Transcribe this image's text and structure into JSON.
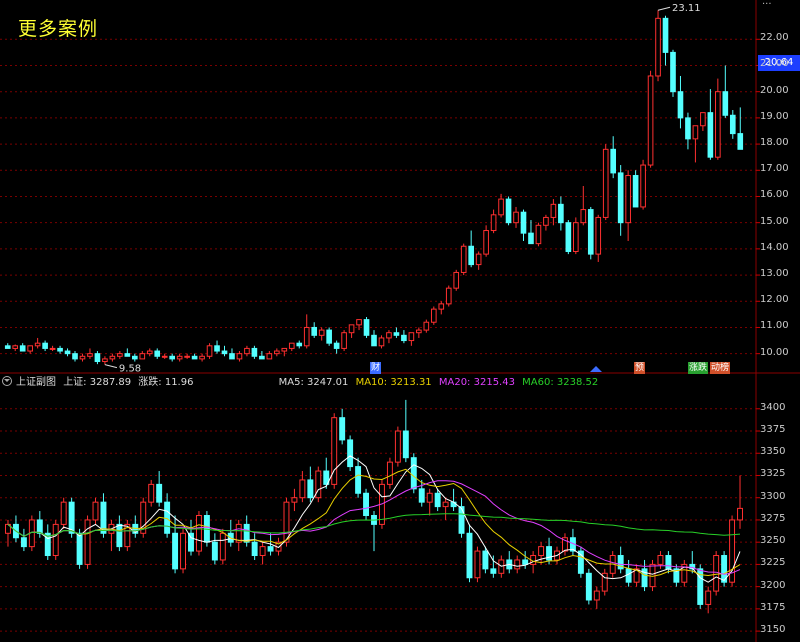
{
  "header": {
    "title": "更多案例"
  },
  "price_tag": "20.64",
  "top_partial_label": "...",
  "main_chart": {
    "y_ticks": [
      "22.00",
      "21.00",
      "20.00",
      "19.00",
      "18.00",
      "17.00",
      "16.00",
      "15.00",
      "14.00",
      "13.00",
      "12.00",
      "11.00",
      "10.00"
    ],
    "y_values": [
      22,
      21,
      20,
      19,
      18,
      17,
      16,
      15,
      14,
      13,
      12,
      11,
      10
    ],
    "ylim": [
      9.3,
      23.5
    ],
    "high_label": "23.11",
    "low_label": "9.58",
    "high_value": 23.11,
    "low_value": 9.58,
    "close_last": 20.64
  },
  "badges": [
    {
      "label": "财",
      "color": "#3b6cff"
    },
    {
      "label": "预",
      "color": "#d0502a"
    },
    {
      "label": "涨跌",
      "color": "#28a030"
    },
    {
      "label": "动榜",
      "color": "#d0502a"
    }
  ],
  "sub_header": {
    "name": "上证副图",
    "index_label": "上证: 3287.89",
    "change_label": "涨跌: 11.96",
    "ma5": "MA5: 3247.01",
    "ma10": "MA10: 3213.31",
    "ma20": "MA20: 3215.43",
    "ma60": "MA60: 3238.52"
  },
  "sub_chart": {
    "y_ticks": [
      "3400",
      "3375",
      "3350",
      "3325",
      "3300",
      "3275",
      "3250",
      "3225",
      "3200",
      "3175",
      "3150"
    ],
    "y_values": [
      3400,
      3375,
      3350,
      3325,
      3300,
      3275,
      3250,
      3225,
      3200,
      3175,
      3150
    ],
    "ylim": [
      3140,
      3420
    ]
  },
  "colors": {
    "up": "#ff3030",
    "down": "#54ffff",
    "grid": "#7a0000",
    "ma5": "#ffffff",
    "ma10": "#e8d000",
    "ma20": "#e040ff",
    "ma60": "#28d028"
  },
  "chart_data": [
    {
      "type": "candlestick",
      "title": "",
      "ylim": [
        9.3,
        23.5
      ],
      "candles": [
        [
          10.3,
          10.4,
          10.2,
          10.2
        ],
        [
          10.2,
          10.35,
          10.1,
          10.3
        ],
        [
          10.3,
          10.4,
          10.2,
          10.1
        ],
        [
          10.1,
          10.3,
          10.0,
          10.3
        ],
        [
          10.3,
          10.6,
          10.2,
          10.4
        ],
        [
          10.4,
          10.5,
          10.1,
          10.2
        ],
        [
          10.2,
          10.3,
          10.1,
          10.2
        ],
        [
          10.2,
          10.3,
          10.0,
          10.1
        ],
        [
          10.1,
          10.2,
          9.9,
          10.0
        ],
        [
          10.0,
          10.1,
          9.7,
          9.8
        ],
        [
          9.8,
          10.0,
          9.7,
          9.9
        ],
        [
          9.9,
          10.2,
          9.8,
          10.0
        ],
        [
          10.0,
          10.1,
          9.6,
          9.7
        ],
        [
          9.7,
          9.9,
          9.58,
          9.8
        ],
        [
          9.8,
          10.0,
          9.7,
          9.9
        ],
        [
          9.9,
          10.1,
          9.8,
          10.0
        ],
        [
          10.0,
          10.2,
          9.9,
          9.9
        ],
        [
          9.9,
          10.0,
          9.7,
          9.8
        ],
        [
          9.8,
          10.1,
          9.8,
          10.0
        ],
        [
          10.0,
          10.2,
          9.9,
          10.1
        ],
        [
          10.1,
          10.2,
          9.8,
          9.9
        ],
        [
          9.9,
          10.0,
          9.8,
          9.9
        ],
        [
          9.9,
          10.0,
          9.7,
          9.8
        ],
        [
          9.8,
          10.0,
          9.7,
          9.9
        ],
        [
          9.9,
          10.0,
          9.8,
          9.9
        ],
        [
          9.9,
          10.0,
          9.8,
          9.8
        ],
        [
          9.8,
          10.0,
          9.7,
          9.9
        ],
        [
          9.9,
          10.4,
          9.8,
          10.3
        ],
        [
          10.3,
          10.5,
          10.0,
          10.1
        ],
        [
          10.1,
          10.3,
          9.9,
          10.0
        ],
        [
          10.0,
          10.2,
          9.8,
          9.8
        ],
        [
          9.8,
          10.1,
          9.7,
          10.0
        ],
        [
          10.0,
          10.3,
          9.9,
          10.2
        ],
        [
          10.2,
          10.3,
          9.8,
          9.9
        ],
        [
          9.9,
          10.1,
          9.8,
          9.8
        ],
        [
          9.8,
          10.1,
          9.8,
          10.0
        ],
        [
          10.0,
          10.2,
          9.9,
          10.1
        ],
        [
          10.1,
          10.2,
          9.9,
          10.2
        ],
        [
          10.2,
          10.4,
          10.1,
          10.4
        ],
        [
          10.4,
          10.5,
          10.2,
          10.3
        ],
        [
          10.3,
          11.5,
          10.2,
          11.0
        ],
        [
          11.0,
          11.2,
          10.6,
          10.7
        ],
        [
          10.7,
          11.0,
          10.5,
          10.9
        ],
        [
          10.9,
          11.0,
          10.3,
          10.4
        ],
        [
          10.4,
          10.5,
          10.0,
          10.2
        ],
        [
          10.2,
          10.9,
          10.1,
          10.8
        ],
        [
          10.8,
          11.1,
          10.6,
          11.1
        ],
        [
          11.1,
          11.3,
          10.9,
          11.3
        ],
        [
          11.3,
          11.4,
          10.6,
          10.7
        ],
        [
          10.7,
          10.9,
          10.3,
          10.3
        ],
        [
          10.3,
          10.7,
          10.2,
          10.6
        ],
        [
          10.6,
          10.9,
          10.4,
          10.8
        ],
        [
          10.8,
          11.0,
          10.6,
          10.7
        ],
        [
          10.7,
          10.9,
          10.4,
          10.5
        ],
        [
          10.5,
          10.8,
          10.3,
          10.8
        ],
        [
          10.8,
          11.0,
          10.6,
          10.9
        ],
        [
          10.9,
          11.3,
          10.8,
          11.2
        ],
        [
          11.2,
          11.8,
          11.1,
          11.7
        ],
        [
          11.7,
          12.0,
          11.5,
          11.9
        ],
        [
          11.9,
          12.6,
          11.8,
          12.5
        ],
        [
          12.5,
          13.2,
          12.4,
          13.1
        ],
        [
          13.1,
          14.2,
          13.0,
          14.1
        ],
        [
          14.1,
          14.7,
          13.3,
          13.4
        ],
        [
          13.4,
          13.9,
          13.2,
          13.8
        ],
        [
          13.8,
          14.9,
          13.7,
          14.7
        ],
        [
          14.7,
          15.5,
          14.6,
          15.3
        ],
        [
          15.3,
          16.1,
          15.2,
          15.9
        ],
        [
          15.9,
          16.0,
          14.9,
          15.0
        ],
        [
          15.0,
          15.6,
          14.8,
          15.4
        ],
        [
          15.4,
          15.5,
          14.3,
          14.6
        ],
        [
          14.6,
          15.1,
          14.2,
          14.2
        ],
        [
          14.2,
          15.0,
          14.1,
          14.9
        ],
        [
          14.9,
          15.3,
          14.7,
          15.2
        ],
        [
          15.2,
          15.9,
          14.9,
          15.7
        ],
        [
          15.7,
          16.0,
          14.7,
          15.0
        ],
        [
          15.0,
          15.1,
          13.8,
          13.9
        ],
        [
          13.9,
          15.2,
          13.8,
          15.0
        ],
        [
          15.0,
          16.4,
          14.9,
          15.5
        ],
        [
          15.5,
          15.6,
          13.6,
          13.8
        ],
        [
          13.8,
          15.3,
          13.5,
          15.2
        ],
        [
          15.2,
          18.0,
          15.1,
          17.8
        ],
        [
          17.8,
          18.3,
          16.7,
          16.9
        ],
        [
          16.9,
          17.2,
          14.5,
          15.0
        ],
        [
          15.0,
          17.0,
          14.3,
          16.8
        ],
        [
          16.8,
          17.0,
          15.6,
          15.6
        ],
        [
          15.6,
          17.4,
          15.5,
          17.2
        ],
        [
          17.2,
          20.8,
          17.1,
          20.6
        ],
        [
          20.6,
          23.11,
          20.4,
          22.8
        ],
        [
          22.8,
          22.9,
          21.0,
          21.5
        ],
        [
          21.5,
          21.6,
          19.8,
          20.0
        ],
        [
          20.0,
          20.6,
          18.6,
          19.0
        ],
        [
          19.0,
          19.2,
          17.8,
          18.2
        ],
        [
          18.2,
          18.7,
          17.3,
          18.7
        ],
        [
          18.7,
          19.2,
          18.5,
          19.2
        ],
        [
          19.2,
          20.1,
          17.4,
          17.5
        ],
        [
          17.5,
          20.5,
          17.4,
          20.0
        ],
        [
          20.0,
          21.0,
          19.0,
          19.1
        ],
        [
          19.1,
          19.3,
          18.2,
          18.4
        ],
        [
          18.4,
          19.4,
          17.8,
          17.8
        ]
      ]
    },
    {
      "type": "candlestick",
      "title": "上证副图",
      "ylim": [
        3140,
        3420
      ],
      "series_names": [
        "MA5",
        "MA10",
        "MA20",
        "MA60"
      ],
      "candles": [
        [
          3260,
          3275,
          3245,
          3270
        ],
        [
          3270,
          3280,
          3250,
          3255
        ],
        [
          3255,
          3265,
          3240,
          3245
        ],
        [
          3245,
          3280,
          3240,
          3275
        ],
        [
          3275,
          3285,
          3255,
          3260
        ],
        [
          3260,
          3270,
          3230,
          3235
        ],
        [
          3235,
          3275,
          3230,
          3270
        ],
        [
          3270,
          3300,
          3265,
          3295
        ],
        [
          3295,
          3300,
          3255,
          3260
        ],
        [
          3260,
          3265,
          3220,
          3225
        ],
        [
          3225,
          3280,
          3220,
          3275
        ],
        [
          3275,
          3300,
          3270,
          3295
        ],
        [
          3295,
          3305,
          3255,
          3260
        ],
        [
          3260,
          3275,
          3240,
          3270
        ],
        [
          3270,
          3280,
          3240,
          3245
        ],
        [
          3245,
          3275,
          3240,
          3270
        ],
        [
          3270,
          3280,
          3255,
          3260
        ],
        [
          3260,
          3300,
          3255,
          3295
        ],
        [
          3295,
          3320,
          3290,
          3315
        ],
        [
          3315,
          3330,
          3290,
          3295
        ],
        [
          3295,
          3305,
          3255,
          3260
        ],
        [
          3260,
          3280,
          3215,
          3220
        ],
        [
          3220,
          3265,
          3215,
          3260
        ],
        [
          3260,
          3275,
          3235,
          3240
        ],
        [
          3240,
          3285,
          3235,
          3280
        ],
        [
          3280,
          3285,
          3245,
          3250
        ],
        [
          3250,
          3260,
          3225,
          3230
        ],
        [
          3230,
          3265,
          3225,
          3260
        ],
        [
          3260,
          3275,
          3245,
          3250
        ],
        [
          3250,
          3275,
          3240,
          3270
        ],
        [
          3270,
          3280,
          3245,
          3250
        ],
        [
          3250,
          3260,
          3230,
          3235
        ],
        [
          3235,
          3250,
          3225,
          3245
        ],
        [
          3245,
          3260,
          3235,
          3240
        ],
        [
          3240,
          3255,
          3235,
          3250
        ],
        [
          3250,
          3300,
          3245,
          3295
        ],
        [
          3295,
          3310,
          3285,
          3300
        ],
        [
          3300,
          3330,
          3295,
          3320
        ],
        [
          3320,
          3335,
          3295,
          3300
        ],
        [
          3300,
          3335,
          3295,
          3330
        ],
        [
          3330,
          3345,
          3310,
          3315
        ],
        [
          3315,
          3395,
          3310,
          3390
        ],
        [
          3390,
          3400,
          3360,
          3365
        ],
        [
          3365,
          3370,
          3330,
          3335
        ],
        [
          3335,
          3345,
          3300,
          3305
        ],
        [
          3305,
          3310,
          3275,
          3280
        ],
        [
          3280,
          3285,
          3240,
          3270
        ],
        [
          3270,
          3320,
          3265,
          3315
        ],
        [
          3315,
          3345,
          3310,
          3340
        ],
        [
          3340,
          3380,
          3335,
          3375
        ],
        [
          3375,
          3410,
          3340,
          3345
        ],
        [
          3345,
          3350,
          3305,
          3310
        ],
        [
          3310,
          3320,
          3290,
          3295
        ],
        [
          3295,
          3310,
          3280,
          3305
        ],
        [
          3305,
          3310,
          3285,
          3290
        ],
        [
          3290,
          3300,
          3275,
          3295
        ],
        [
          3295,
          3310,
          3285,
          3290
        ],
        [
          3290,
          3300,
          3255,
          3260
        ],
        [
          3260,
          3270,
          3205,
          3210
        ],
        [
          3210,
          3245,
          3205,
          3240
        ],
        [
          3240,
          3245,
          3215,
          3220
        ],
        [
          3220,
          3235,
          3210,
          3215
        ],
        [
          3215,
          3235,
          3210,
          3230
        ],
        [
          3230,
          3240,
          3215,
          3220
        ],
        [
          3220,
          3235,
          3215,
          3230
        ],
        [
          3230,
          3240,
          3220,
          3225
        ],
        [
          3225,
          3240,
          3215,
          3235
        ],
        [
          3235,
          3250,
          3225,
          3245
        ],
        [
          3245,
          3255,
          3225,
          3230
        ],
        [
          3230,
          3245,
          3225,
          3240
        ],
        [
          3240,
          3260,
          3235,
          3255
        ],
        [
          3255,
          3265,
          3235,
          3240
        ],
        [
          3240,
          3245,
          3210,
          3215
        ],
        [
          3215,
          3220,
          3180,
          3185
        ],
        [
          3185,
          3200,
          3175,
          3195
        ],
        [
          3195,
          3220,
          3190,
          3215
        ],
        [
          3215,
          3240,
          3210,
          3235
        ],
        [
          3235,
          3245,
          3215,
          3220
        ],
        [
          3220,
          3230,
          3200,
          3205
        ],
        [
          3205,
          3225,
          3200,
          3220
        ],
        [
          3220,
          3230,
          3195,
          3200
        ],
        [
          3200,
          3230,
          3195,
          3225
        ],
        [
          3225,
          3240,
          3220,
          3235
        ],
        [
          3235,
          3240,
          3215,
          3220
        ],
        [
          3220,
          3225,
          3200,
          3205
        ],
        [
          3205,
          3230,
          3200,
          3225
        ],
        [
          3225,
          3240,
          3215,
          3220
        ],
        [
          3220,
          3225,
          3175,
          3180
        ],
        [
          3180,
          3200,
          3170,
          3195
        ],
        [
          3195,
          3240,
          3190,
          3235
        ],
        [
          3235,
          3240,
          3200,
          3205
        ],
        [
          3205,
          3280,
          3200,
          3275
        ],
        [
          3275,
          3325,
          3265,
          3288
        ]
      ]
    }
  ]
}
